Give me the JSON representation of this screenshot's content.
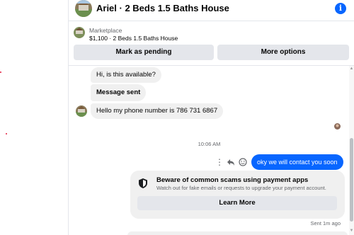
{
  "header": {
    "title": "Ariel · 2 Beds 1.5 Baths House",
    "info_icon": "info-icon",
    "info_glyph": "i"
  },
  "marketplace": {
    "label": "Marketplace",
    "item": "$1,100 · 2 Beds 1.5 Baths House",
    "buttons": {
      "mark_pending": "Mark as pending",
      "more_options": "More options"
    }
  },
  "thread": {
    "incoming": [
      "Hi, is this available?",
      "Message sent",
      "Hello my phone number is 786 731 6867"
    ],
    "timestamp": "10:06 AM",
    "outgoing": "oky we will contact you soon",
    "warning": {
      "title": "Beware of common scams using payment apps",
      "subtitle": "Watch out for fake emails or requests to upgrade your payment account.",
      "button": "Learn More"
    },
    "sent_status": "Sent 1m ago"
  },
  "colors": {
    "accent": "#0866ff",
    "bubble_in": "#f0f0f0",
    "button_bg": "#e4e6eb",
    "secondary_text": "#65676b"
  }
}
